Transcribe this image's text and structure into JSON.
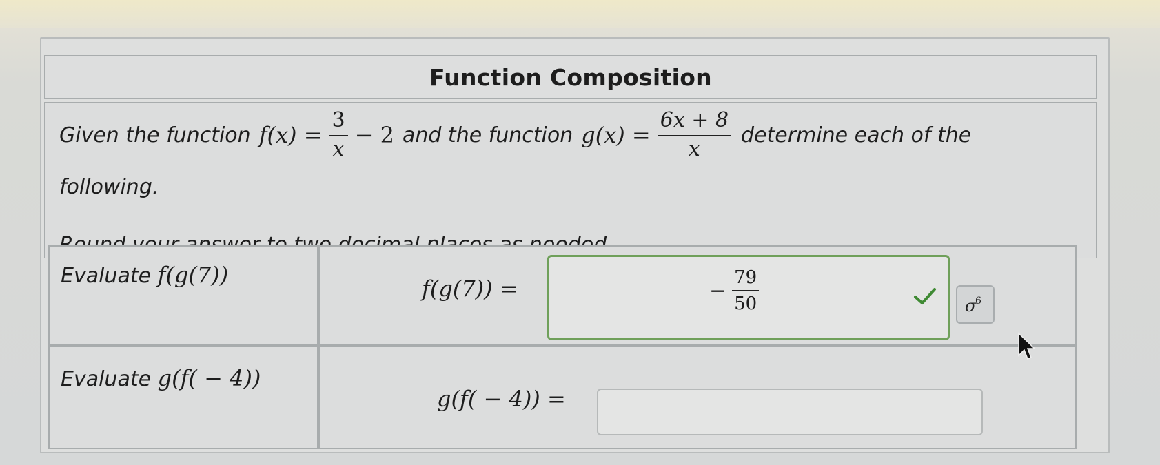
{
  "title": "Function Composition",
  "problem": {
    "intro": "Given the function",
    "f_lhs": "f(x) =",
    "f_num": "3",
    "f_den": "x",
    "f_tail": "− 2",
    "connector": "and the function",
    "g_lhs": "g(x) =",
    "g_num": "6x + 8",
    "g_den": "x",
    "tail": "determine each of the",
    "line2": "following.",
    "instruction": "Round your answer to two decimal places as needed."
  },
  "rows": [
    {
      "prompt_word": "Evaluate",
      "prompt_math": "f(g(7))",
      "label": "f(g(7)) =",
      "answer_sign": "−",
      "answer_num": "79",
      "answer_den": "50",
      "status": "correct"
    },
    {
      "prompt_word": "Evaluate",
      "prompt_math": "g(f( − 4))",
      "label": "g(f( − 4)) =",
      "value": "",
      "placeholder": ""
    }
  ],
  "icons": {
    "check": "check-icon",
    "keypad": "math-keypad-icon",
    "cursor": "mouse-pointer-icon"
  },
  "colors": {
    "correct_border": "#6fa05a",
    "check_green": "#3f8a33"
  }
}
